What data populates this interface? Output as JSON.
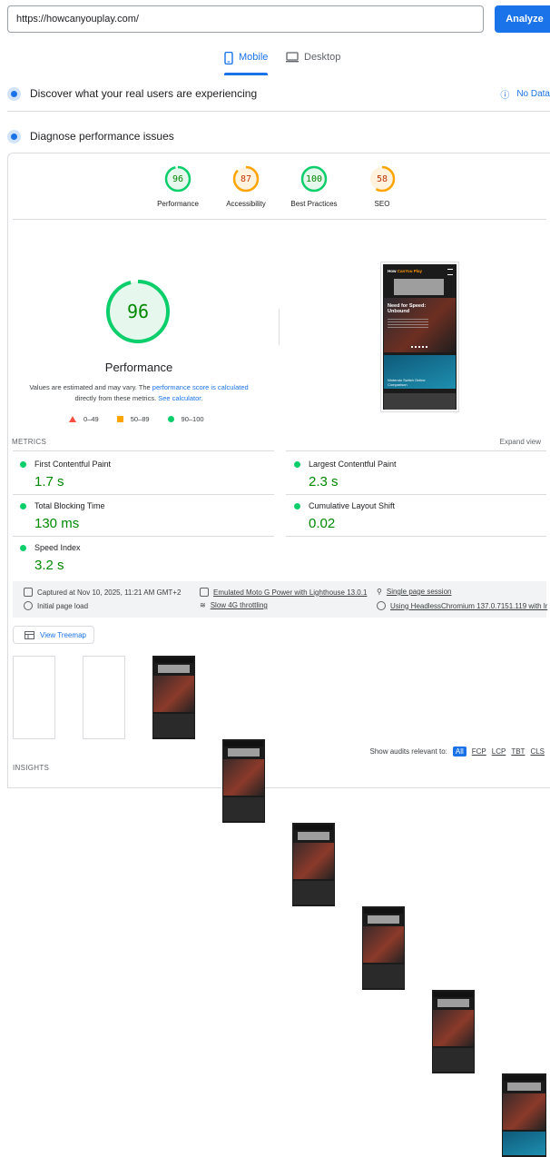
{
  "url_bar": {
    "value": "https://howcanyouplay.com/",
    "analyze_label": "Analyze"
  },
  "tabs": {
    "mobile": "Mobile",
    "desktop": "Desktop"
  },
  "field_data": {
    "title": "Discover what your real users are experiencing",
    "no_data": "No Data"
  },
  "diagnose": {
    "title": "Diagnose performance issues"
  },
  "categories": [
    {
      "score": "96",
      "label": "Performance",
      "fraction": 0.96
    },
    {
      "score": "87",
      "label": "Accessibility",
      "fraction": 0.87
    },
    {
      "score": "100",
      "label": "Best Practices",
      "fraction": 1.0
    },
    {
      "score": "58",
      "label": "SEO",
      "fraction": 0.58
    }
  ],
  "main_gauge": {
    "score": "96",
    "label": "Performance",
    "fraction": 0.96
  },
  "note": {
    "prefix": "Values are estimated and may vary. The ",
    "link1": "performance score is calculated",
    "middle": "directly from these metrics. ",
    "link2": "See calculator."
  },
  "legend": {
    "bad": "0–49",
    "average": "50–89",
    "good": "90–100"
  },
  "screenshot_preview": {
    "logo_a": "How",
    "logo_b": "Can",
    "logo_c": "You",
    "logo_d": "Play",
    "hero_title": "Need for Speed: Unbound",
    "card_title": "Nintendo Switch Online Comparison"
  },
  "metrics_header": {
    "title": "METRICS",
    "expand": "Expand view"
  },
  "metrics": [
    {
      "name": "First Contentful Paint",
      "value": "1.7 s"
    },
    {
      "name": "Largest Contentful Paint",
      "value": "2.3 s"
    },
    {
      "name": "Total Blocking Time",
      "value": "130 ms"
    },
    {
      "name": "Cumulative Layout Shift",
      "value": "0.02"
    },
    {
      "name": "Speed Index",
      "value": "3.2 s"
    }
  ],
  "run_info": {
    "captured": "Captured at Nov 10, 2025, 11:21 AM GMT+2",
    "device": "Emulated Moto G Power with Lighthouse 13.0.1",
    "session": "Single page session",
    "load": "Initial page load",
    "throttle": "Slow 4G throttling",
    "browser": "Using HeadlessChromium 137.0.7151.119 with lr"
  },
  "treemap_label": "View Treemap",
  "audit_filter": {
    "label": "Show audits relevant to:",
    "options": [
      "All",
      "FCP",
      "LCP",
      "TBT",
      "CLS"
    ]
  },
  "insights_title": "INSIGHTS",
  "colors": {
    "accent": "#1a73e8",
    "good": "#0cce6b",
    "average": "#ffa400",
    "bad": "#ff4e42"
  }
}
